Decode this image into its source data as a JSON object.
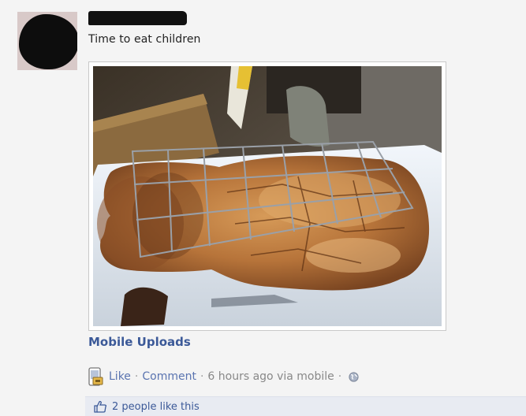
{
  "post": {
    "message": "Time to eat children",
    "album_label": "Mobile Uploads",
    "actions": {
      "like": "Like",
      "comment": "Comment",
      "timestamp": "6 hours ago via mobile"
    },
    "likes_text": "2 people like this"
  },
  "icons": {
    "mobile": "mobile-phone-icon",
    "privacy": "globe-icon",
    "like": "thumbs-up-icon"
  },
  "colors": {
    "link": "#3b5998",
    "background": "#f4f4f4",
    "likes_bar": "#e8ebf2"
  }
}
